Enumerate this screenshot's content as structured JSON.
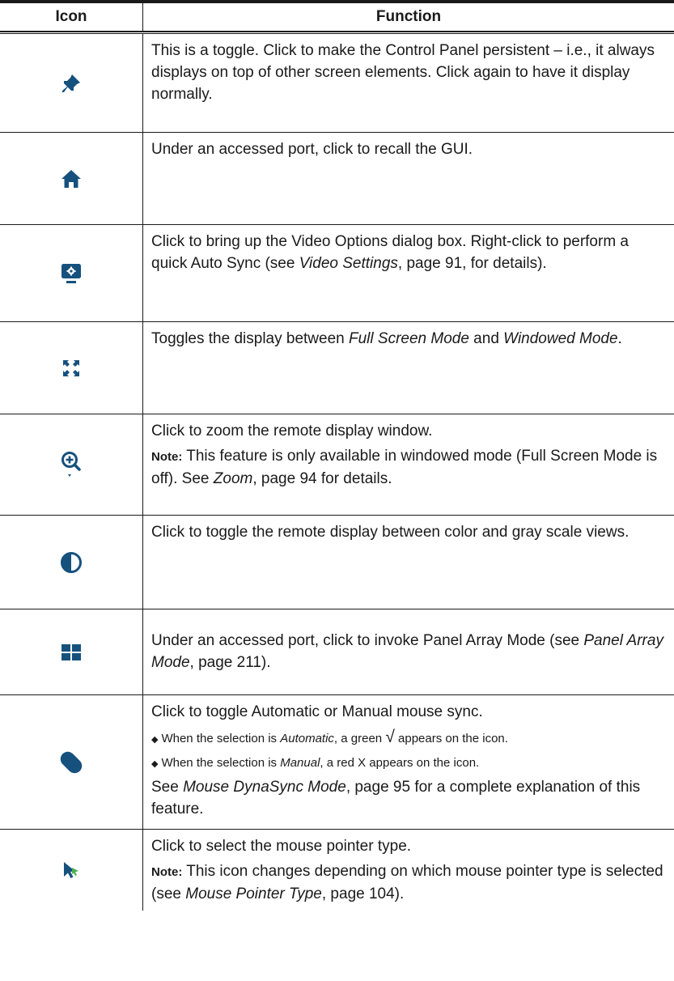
{
  "header": {
    "col_icon": "Icon",
    "col_function": "Function"
  },
  "rows": [
    {
      "icon": "pin-icon",
      "text": "This is a toggle. Click to make the Control Panel persistent – i.e., it always displays on top of other screen elements. Click again to have it display normally."
    },
    {
      "icon": "home-icon",
      "text": "Under an accessed port, click to recall the GUI."
    },
    {
      "icon": "video-settings-icon",
      "text_a": "Click to bring up the Video Options dialog box. Right-click to perform a quick Auto Sync (see ",
      "text_ref": "Video Settings",
      "text_b": ", page 91, for details)."
    },
    {
      "icon": "fullscreen-icon",
      "text_a": "Toggles the display between ",
      "text_ref1": "Full Screen Mode",
      "text_mid": " and ",
      "text_ref2": "Windowed Mode",
      "text_b": "."
    },
    {
      "icon": "zoom-icon",
      "text": "Click to zoom the remote display window.",
      "note_label": "Note:",
      "note_a": " This feature is only available in windowed mode (Full Screen Mode is off). See ",
      "note_ref": "Zoom",
      "note_b": ", page 94 for details."
    },
    {
      "icon": "contrast-icon",
      "text": "Click to toggle the remote display between color and gray scale views."
    },
    {
      "icon": "panel-array-icon",
      "text_a": "Under an accessed port, click to invoke Panel Array Mode (see ",
      "text_ref": "Panel Array Mode",
      "text_b": ", page 211)."
    },
    {
      "icon": "mouse-icon",
      "text": "Click to toggle Automatic or Manual mouse sync.",
      "bullet1_a": "When the selection is ",
      "bullet1_ref": "Automatic",
      "bullet1_b": ", a green ",
      "bullet1_check": "√",
      "bullet1_c": " appears on the icon.",
      "bullet2_a": "When the selection is ",
      "bullet2_ref": "Manual",
      "bullet2_b": ", a red X appears on the icon.",
      "see_a": "See ",
      "see_ref": "Mouse DynaSync Mode",
      "see_b": ", page 95 for a complete explanation of this feature."
    },
    {
      "icon": "mouse-pointer-icon",
      "text": "Click to select the mouse pointer type.",
      "note_label": "Note:",
      "note_a": " This icon changes depending on which mouse pointer type is selected (see ",
      "note_ref": "Mouse Pointer Type",
      "note_b": ", page 104)."
    }
  ],
  "colors": {
    "icon_blue": "#16517e",
    "pointer_green": "#4caf50",
    "rule": "#1a1a1a"
  }
}
